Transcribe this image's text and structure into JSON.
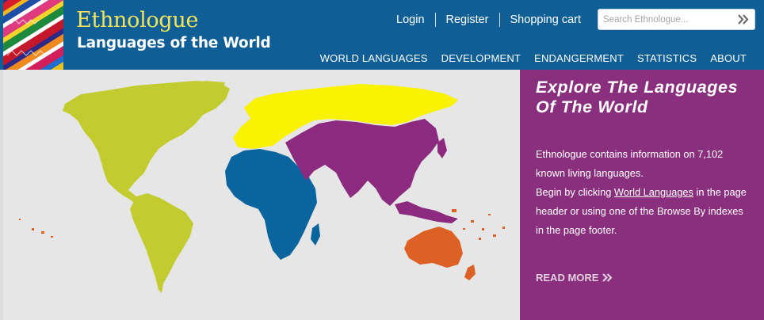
{
  "header": {
    "logo_title": "Ethnologue",
    "logo_subtitle": "Languages of the World",
    "top_links": [
      "Login",
      "Register",
      "Shopping cart"
    ],
    "search": {
      "placeholder": "Search Ethnologue..."
    },
    "nav": [
      "WORLD LANGUAGES",
      "DEVELOPMENT",
      "ENDANGERMENT",
      "STATISTICS",
      "ABOUT"
    ]
  },
  "hero": {
    "title": "Explore The Languages Of The World",
    "text_before_count": "Ethnologue contains information on ",
    "count": "7,102",
    "text_after_count": " known living languages.",
    "text_begin": "Begin by clicking ",
    "link_label": "World Languages",
    "text_end": " in the page header or using one of the Browse By indexes in the page footer.",
    "read_more": "READ MORE"
  },
  "map": {
    "region_colors": {
      "americas": "#c3cc2e",
      "africa": "#0a659f",
      "europe": "#f9f200",
      "asia": "#8c2a80",
      "pacific": "#dd6125"
    }
  },
  "colors": {
    "header_bg": "#0f5f96",
    "panel_bg": "#8a2f7d",
    "logo_title": "#f2e45a"
  }
}
